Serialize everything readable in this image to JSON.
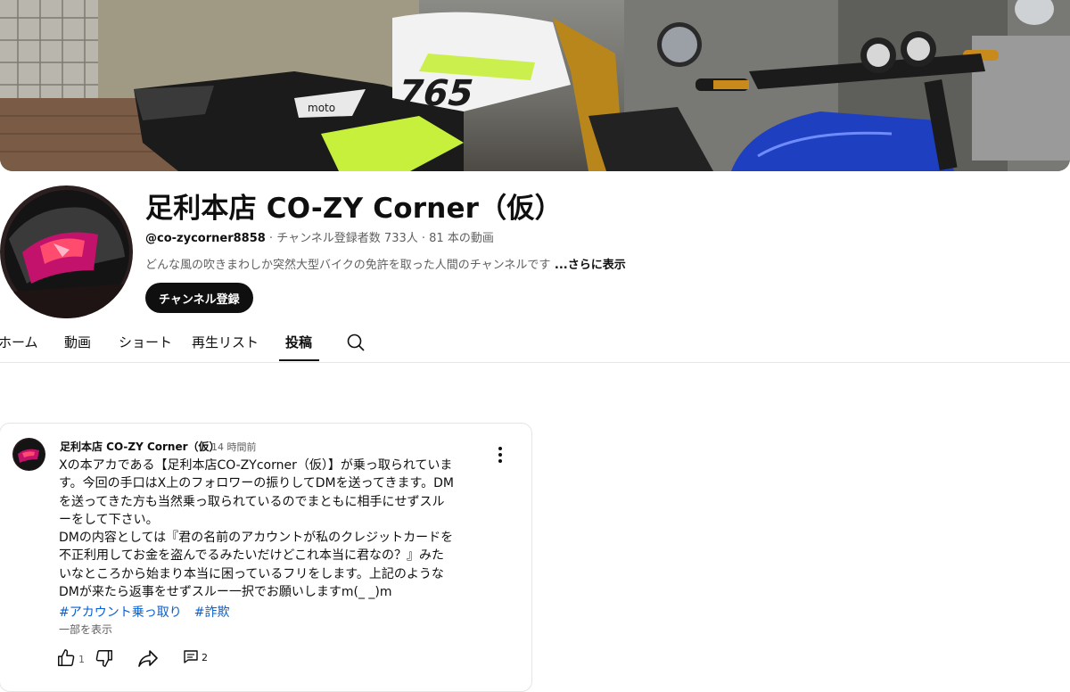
{
  "channel": {
    "title": "足利本店 CO-ZY Corner（仮）",
    "handle": "@co-zycorner8858",
    "meta_rest": " · チャンネル登録者数 733人 · 81 本の動画",
    "description": "どんな風の吹きまわしか突然大型バイクの免許を取った人間のチャンネルです",
    "more_label": " ...さらに表示",
    "subscribe_label": "チャンネル登録",
    "banner_bike_text": "765",
    "banner_sticker": "moto"
  },
  "tabs": [
    {
      "label": "ホーム"
    },
    {
      "label": "動画"
    },
    {
      "label": "ショート"
    },
    {
      "label": "再生リスト"
    },
    {
      "label": "投稿"
    }
  ],
  "active_tab": "投稿",
  "post": {
    "author": "足利本店 CO-ZY Corner（仮）",
    "time": "14 時間前",
    "lines": [
      "Xの本アカである【足利本店CO-ZYcorner（仮）】が乗っ取られていま",
      "す。今回の手口はX上のフォロワーの振りしてDMを送ってきます。DM",
      "を送ってきた方も当然乗っ取られているのでまともに相手にせずスル",
      "ーをして下さい。",
      "DMの内容としては『君の名前のアカウントが私のクレジットカードを",
      "不正利用してお金を盗んでるみたいだけどこれ本当に君なの？』みた",
      "いなところから始まり本当に困っているフリをします。上記のような",
      "DMが来たら返事をせずスルー一択でお願いしますm(_ _)m"
    ],
    "hashtags": [
      "#アカウント乗っ取り",
      "#詐欺"
    ],
    "show_more": "一部を表示",
    "like_count": "1",
    "comment_count": "2"
  },
  "colors": {
    "link": "#065fd4",
    "subscribe_bg": "#0f0f0f",
    "bike_white": "#f2f2f2",
    "bike_green": "#c6f03c",
    "tank_blue": "#1e3fbf",
    "brass": "#c98a1c"
  },
  "icons": [
    "search-icon",
    "more-vert-icon",
    "like-icon",
    "dislike-icon",
    "share-icon",
    "comment-icon"
  ]
}
